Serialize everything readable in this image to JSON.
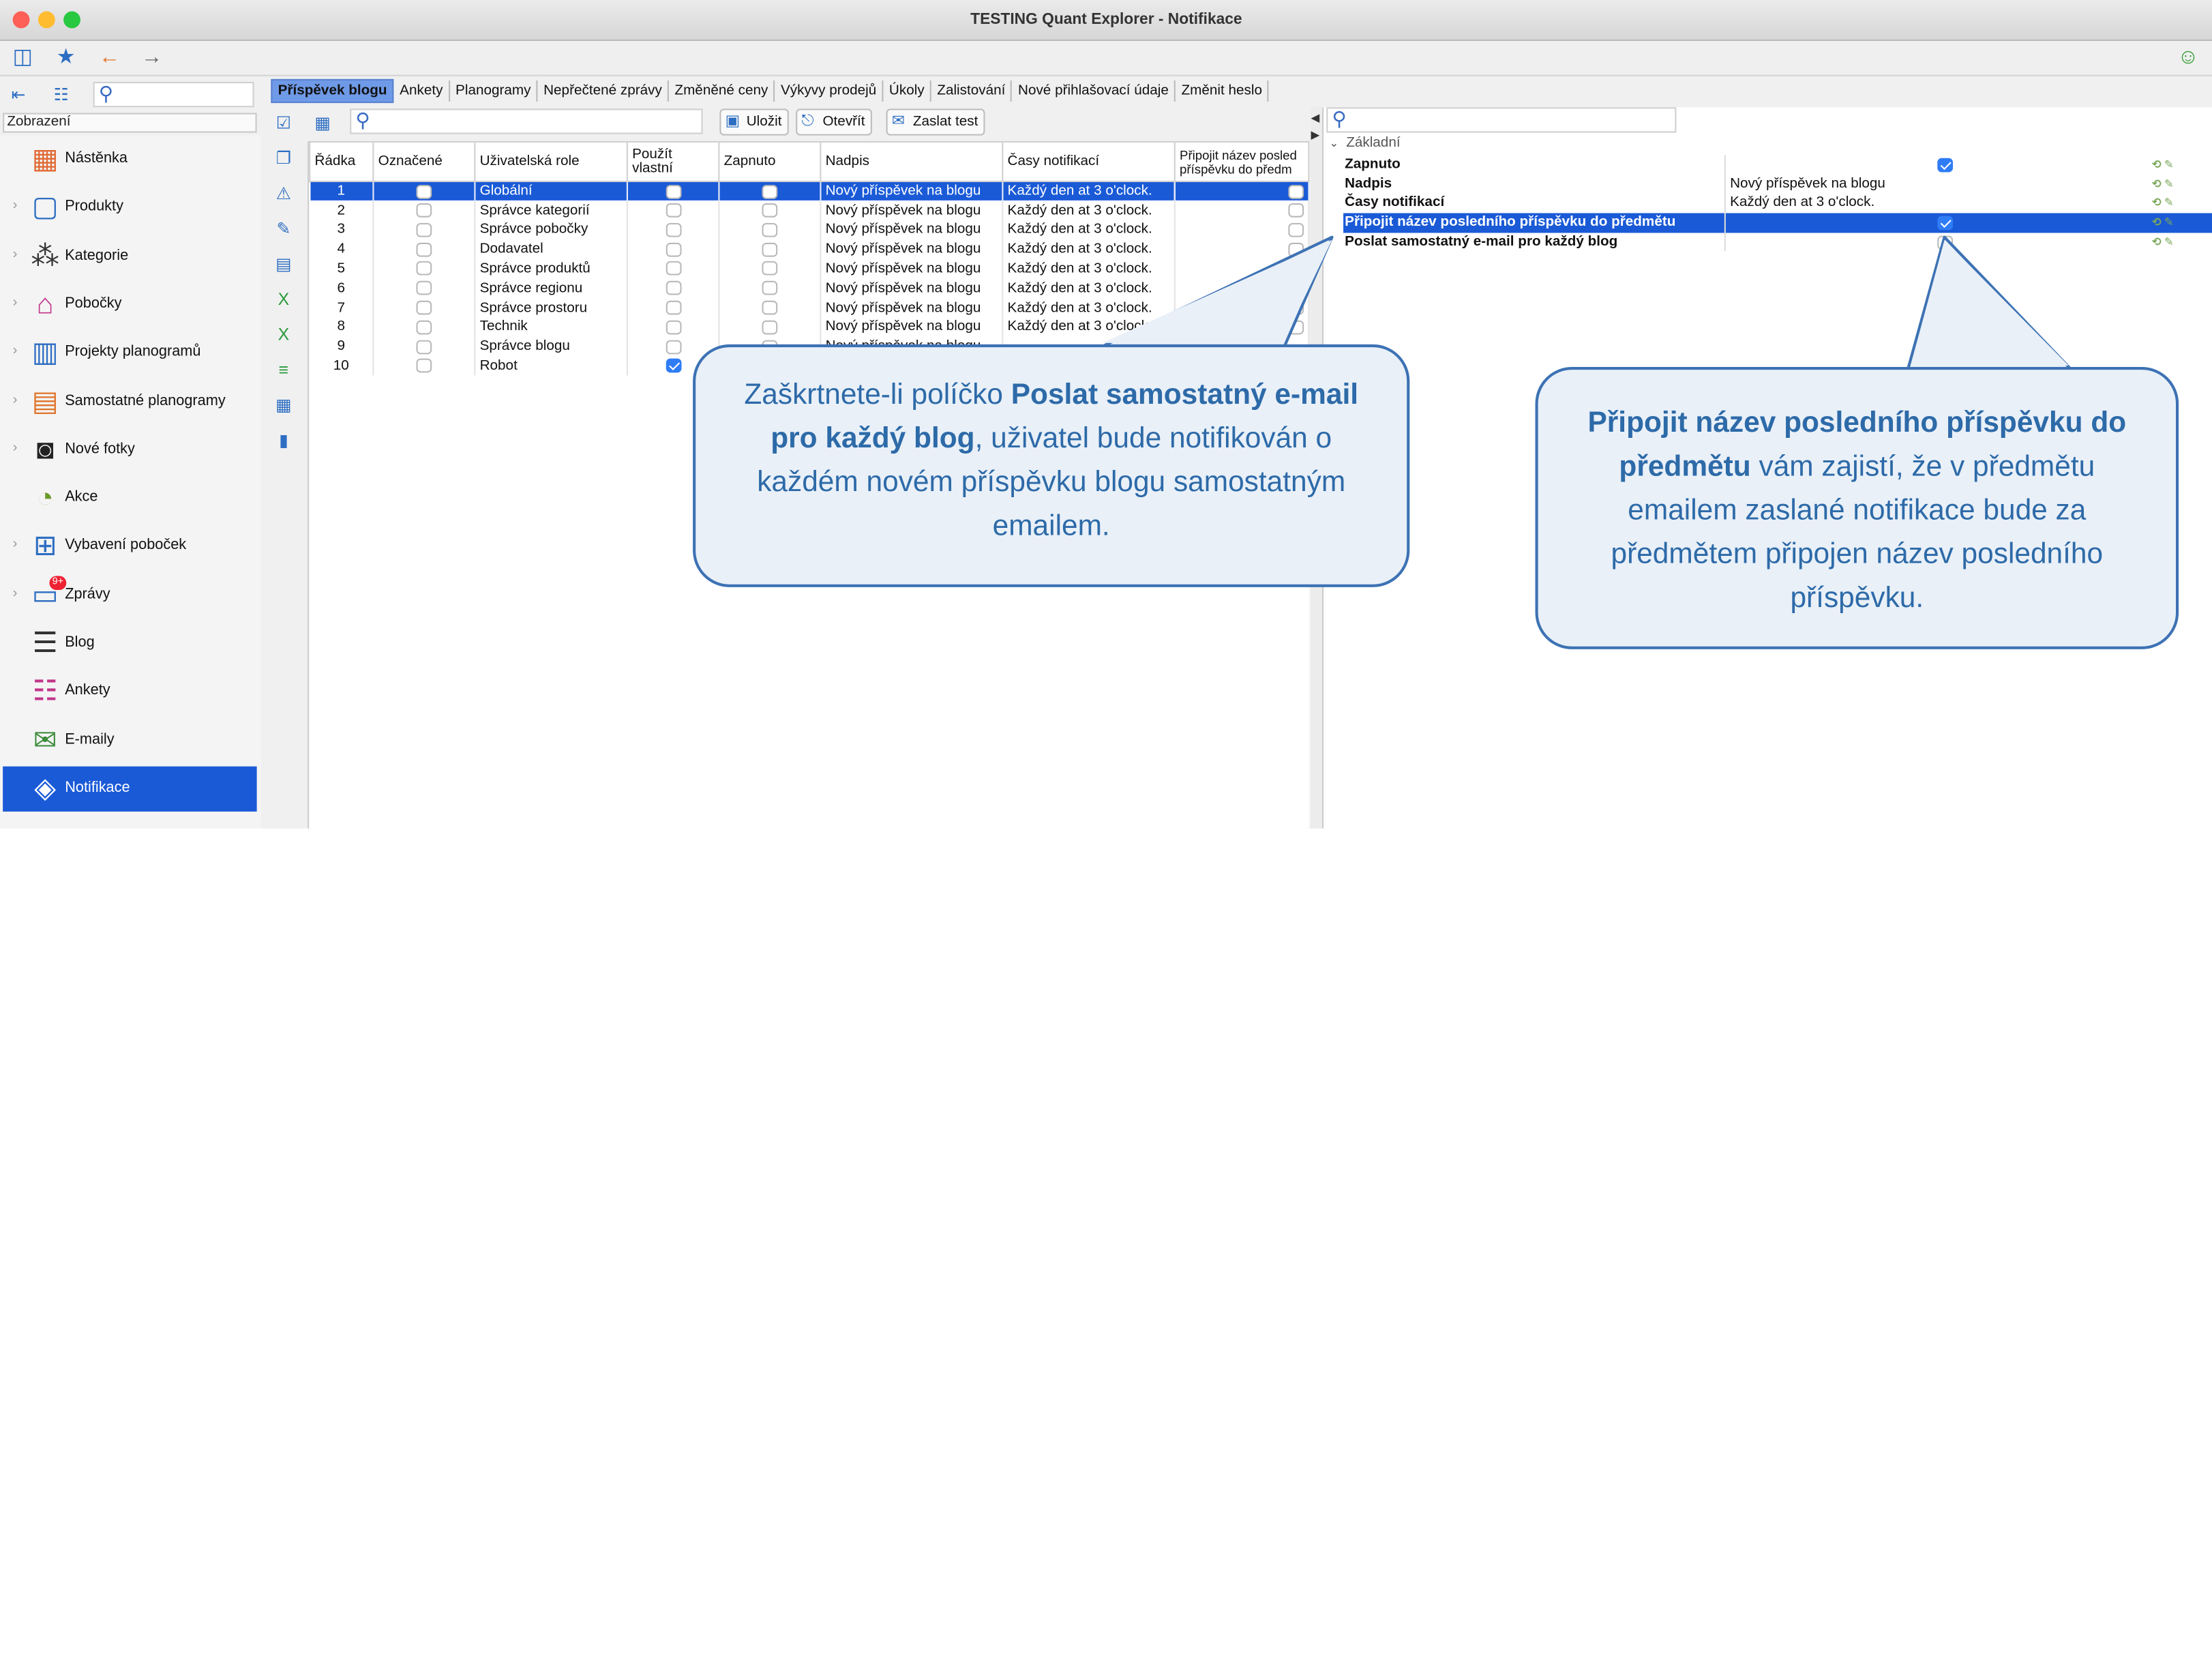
{
  "window": {
    "title": "TESTING Quant Explorer - Notifikace",
    "lights": {
      "close": "#fe5f57",
      "minimize": "#febc2e",
      "zoom": "#28c840"
    }
  },
  "toolbar": {
    "icons": [
      "sidebar-toggle-icon",
      "star-icon",
      "arrow-left-icon",
      "arrow-right-icon",
      "smiley-icon"
    ]
  },
  "sidebar": {
    "search": {
      "value": ""
    },
    "section_label": "Zobrazení",
    "items": [
      {
        "label": "Nástěnka",
        "icon": "dashboard-icon",
        "expandable": false
      },
      {
        "label": "Produkty",
        "icon": "product-icon",
        "expandable": true
      },
      {
        "label": "Kategorie",
        "icon": "category-icon",
        "expandable": true
      },
      {
        "label": "Pobočky",
        "icon": "store-icon",
        "expandable": true
      },
      {
        "label": "Projekty planogramů",
        "icon": "planogram-project-icon",
        "expandable": true
      },
      {
        "label": "Samostatné planogramy",
        "icon": "planogram-icon",
        "expandable": true
      },
      {
        "label": "Nové fotky",
        "icon": "camera-icon",
        "expandable": true
      },
      {
        "label": "Akce",
        "icon": "clock-icon",
        "expandable": false
      },
      {
        "label": "Vybavení poboček",
        "icon": "equipment-icon",
        "expandable": true
      },
      {
        "label": "Zprávy",
        "icon": "message-icon",
        "expandable": true,
        "badge": "9+"
      },
      {
        "label": "Blog",
        "icon": "blog-icon",
        "expandable": false
      },
      {
        "label": "Ankety",
        "icon": "survey-icon",
        "expandable": false
      },
      {
        "label": "E-maily",
        "icon": "email-icon",
        "expandable": false
      },
      {
        "label": "Notifikace",
        "icon": "notification-icon",
        "expandable": false,
        "active": true
      }
    ]
  },
  "tabs": [
    {
      "label": "Příspěvek blogu",
      "active": true
    },
    {
      "label": "Ankety"
    },
    {
      "label": "Planogramy"
    },
    {
      "label": "Nepřečtené zprávy"
    },
    {
      "label": "Změněné ceny"
    },
    {
      "label": "Výkyvy prodejů"
    },
    {
      "label": "Úkoly"
    },
    {
      "label": "Zalistování"
    },
    {
      "label": "Nové přihlašovací údaje"
    },
    {
      "label": "Změnit heslo"
    }
  ],
  "content_toolbar": {
    "search": {
      "value": ""
    },
    "save_label": "Uložit",
    "open_label": "Otevřít",
    "send_test_label": "Zaslat test"
  },
  "grid": {
    "columns": [
      "Řádka",
      "Označené",
      "Uživatelská role",
      "Použít vlastní",
      "Zapnuto",
      "Nadpis",
      "Časy notifikací",
      "Připojit název posled příspěvku do předm"
    ],
    "rows": [
      {
        "n": "1",
        "role": "Globální",
        "own": "off",
        "on": "off",
        "title": "Nový příspěvek na blogu",
        "times": "Každý den at 3 o'clock.",
        "attach": "off",
        "selected": true
      },
      {
        "n": "2",
        "role": "Správce kategorií",
        "own": "off",
        "on": "off",
        "title": "Nový příspěvek na blogu",
        "times": "Každý den at 3 o'clock.",
        "attach": "off"
      },
      {
        "n": "3",
        "role": "Správce pobočky",
        "own": "off",
        "on": "off",
        "title": "Nový příspěvek na blogu",
        "times": "Každý den at 3 o'clock.",
        "attach": "off"
      },
      {
        "n": "4",
        "role": "Dodavatel",
        "own": "off",
        "on": "off",
        "title": "Nový příspěvek na blogu",
        "times": "Každý den at 3 o'clock.",
        "attach": "off"
      },
      {
        "n": "5",
        "role": "Správce produktů",
        "own": "off",
        "on": "off",
        "title": "Nový příspěvek na blogu",
        "times": "Každý den at 3 o'clock.",
        "attach": "off"
      },
      {
        "n": "6",
        "role": "Správce regionu",
        "own": "off",
        "on": "off",
        "title": "Nový příspěvek na blogu",
        "times": "Každý den at 3 o'clock.",
        "attach": "off"
      },
      {
        "n": "7",
        "role": "Správce prostoru",
        "own": "off",
        "on": "off",
        "title": "Nový příspěvek na blogu",
        "times": "Každý den at 3 o'clock.",
        "attach": "off"
      },
      {
        "n": "8",
        "role": "Technik",
        "own": "off",
        "on": "off",
        "title": "Nový příspěvek na blogu",
        "times": "Každý den at 3 o'clock.",
        "attach": "off"
      },
      {
        "n": "9",
        "role": "Správce blogu",
        "own": "off",
        "on": "off",
        "title": "Nový příspěvek na blogu",
        "times": "",
        "attach": ""
      },
      {
        "n": "10",
        "role": "Robot",
        "own": "on",
        "on": "",
        "title": "",
        "times": "",
        "attach": ""
      }
    ]
  },
  "properties": {
    "search": {
      "value": ""
    },
    "group": "Základní",
    "rows": [
      {
        "key": "Zapnuto",
        "value": "",
        "check": "on"
      },
      {
        "key": "Nadpis",
        "value": "Nový příspěvek na blogu"
      },
      {
        "key": "Časy notifikací",
        "value": "Každý den at 3 o'clock."
      },
      {
        "key": "Připojit název posledního příspěvku do předmětu",
        "value": "",
        "check": "on",
        "selected": true
      },
      {
        "key": "Poslat samostatný e-mail pro každý blog",
        "value": "",
        "check": "off"
      }
    ]
  },
  "callouts": {
    "left": {
      "p1": "Zaškrtnete-li políčko ",
      "b1": "Poslat samostatný e-mail pro každý blog",
      "p2": ", uživatel bude notifikován o každém novém příspěvku blogu samostatným emailem."
    },
    "right": {
      "b1": "Připojit název posledního příspěvku do předmětu",
      "p1": " vám zajistí, že v předmětu emailem zaslané notifikace bude za předmětem připojen název posledního příspěvku."
    }
  },
  "colors": {
    "accent": "#1a5ad7",
    "callout_border": "#3d72b4",
    "callout_fill": "#e9f0f8",
    "callout_text": "#2d6aa8"
  }
}
